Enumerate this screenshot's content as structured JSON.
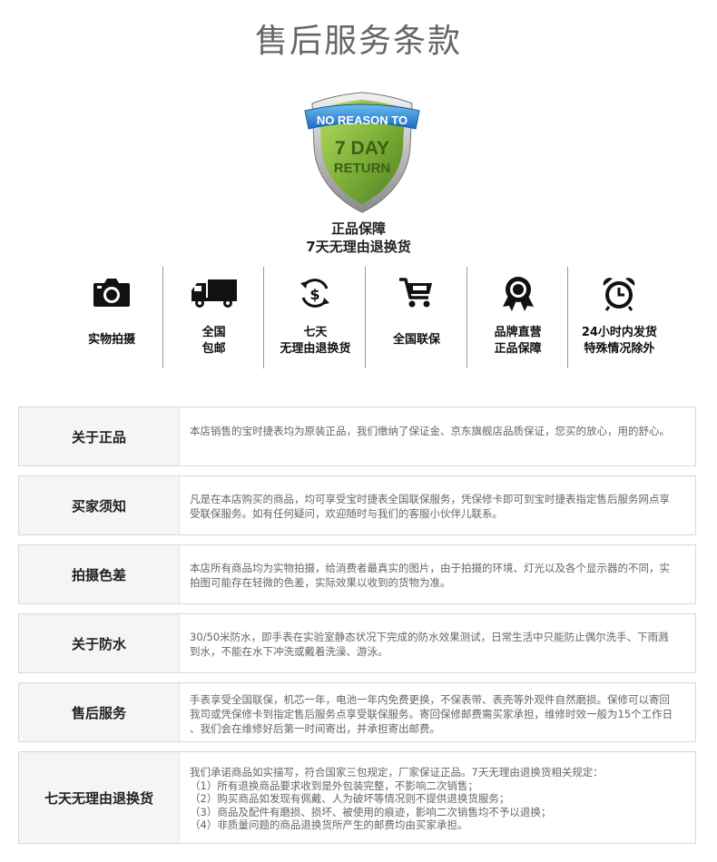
{
  "page_title": "售后服务条款",
  "badge": {
    "line1": "NO REASON TO",
    "line2": "7 DAY",
    "line3": "RETURN"
  },
  "guarantee": {
    "line1": "正品保障",
    "line2": "7天无理由退换货"
  },
  "icons": [
    {
      "icon": "camera-icon",
      "lines": [
        "实物拍摄"
      ]
    },
    {
      "icon": "truck-icon",
      "lines": [
        "全国",
        "包邮"
      ]
    },
    {
      "icon": "refund-cycle-icon",
      "lines": [
        "七天",
        "无理由退换货"
      ]
    },
    {
      "icon": "cart-icon",
      "lines": [
        "全国联保"
      ]
    },
    {
      "icon": "award-ribbon-icon",
      "lines": [
        "品牌直营",
        "正品保障"
      ]
    },
    {
      "icon": "alarm-clock-icon",
      "lines": [
        "24小时内发货",
        "特殊情况除外"
      ]
    }
  ],
  "terms": [
    {
      "heading": "关于正品",
      "lines": [
        "本店销售的宝时捷表均为原装正品，我们缴纳了保证金、京东旗舰店品质保证，您买的放心，用的舒心。"
      ]
    },
    {
      "heading": "买家须知",
      "lines": [
        "凡是在本店购买的商品，均可享受宝时捷表全国联保服务，凭保修卡即可到宝时捷表指定售后服务网点享",
        "受联保服务。如有任何疑问，欢迎随时与我们的客服小伙伴儿联系。"
      ]
    },
    {
      "heading": "拍摄色差",
      "lines": [
        "本店所有商品均为实物拍摄，给消费者最真实的图片，由于拍摄的环境、灯光以及各个显示器的不同，实",
        "拍图可能存在轻微的色差，实际效果以收到的货物为准。"
      ]
    },
    {
      "heading": "关于防水",
      "lines": [
        "30/50米防水，即手表在实验室静态状况下完成的防水效果测试，日常生活中只能防止偶尔洗手、下雨溅",
        "到水，不能在水下冲洗或戴着洗澡、游泳。"
      ]
    },
    {
      "heading": "售后服务",
      "lines": [
        "手表享受全国联保，机芯一年，电池一年内免费更换，不保表带、表壳等外观件自然磨损。保修可以寄回",
        "我司或凭保修卡到指定售后服务点享受联保服务。寄回保修邮费需买家承担，维修时效一般为15个工作日",
        "、我们会在维修好后第一时间寄出，并承担寄出邮费。"
      ]
    },
    {
      "heading": "七天无理由退换货",
      "lines": [
        "我们承诺商品如实描写，符合国家三包规定，厂家保证正品。7天无理由退换货相关规定：",
        "（1）所有退换商品要求收到是外包装完整，不影响二次销售；",
        "（2）购买商品如发现有佩戴、人为破坏等情况则不提供退换货服务；",
        "（3）商品及配件有磨损、损坏、被使用的痕迹，影响二次销售均不予以退换；",
        "（4）非质量问题的商品退换货所产生的邮费均由买家承担。"
      ]
    }
  ],
  "colors": {
    "shield_green": "#7fb23a",
    "ribbon_blue": "#2b8ad8",
    "text_gray": "#666666"
  }
}
